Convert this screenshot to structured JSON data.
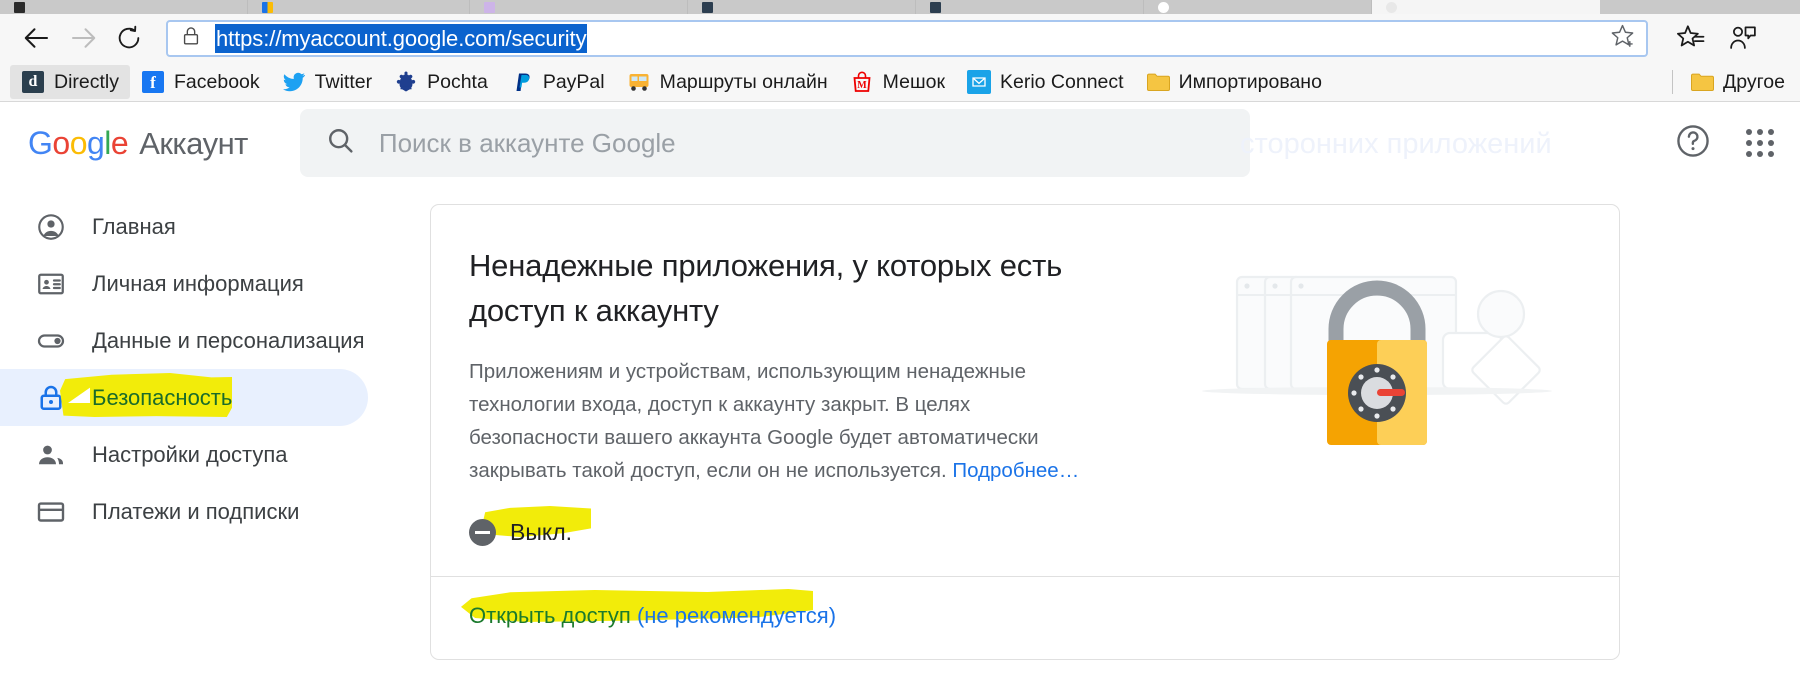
{
  "browser": {
    "nav": {
      "back_icon": "arrow-left-icon",
      "forward_icon": "arrow-right-icon",
      "reload_icon": "reload-icon",
      "lock_icon": "lock-icon",
      "url": "https://myaccount.google.com/security",
      "favorite_icon": "star-add-icon",
      "favorites_list_icon": "favorites-list-icon",
      "collections_icon": "collections-icon",
      "windows_icon": "windows-logo-icon"
    },
    "bookmarks": [
      {
        "label": "Directly",
        "icon": "directly-favicon"
      },
      {
        "label": "Facebook",
        "icon": "facebook-favicon"
      },
      {
        "label": "Twitter",
        "icon": "twitter-favicon"
      },
      {
        "label": "Pochta",
        "icon": "pochta-favicon"
      },
      {
        "label": "PayPal",
        "icon": "paypal-favicon"
      },
      {
        "label": "Маршруты онлайн",
        "icon": "routes-favicon"
      },
      {
        "label": "Мешок",
        "icon": "meshok-favicon"
      },
      {
        "label": "Kerio Connect",
        "icon": "kerio-favicon"
      },
      {
        "label": "Импортировано",
        "icon": "folder-icon"
      }
    ],
    "bookmarks_overflow": {
      "label": "Другое",
      "icon": "folder-icon"
    }
  },
  "header": {
    "logo": {
      "g1": "G",
      "o1": "o",
      "o2": "o",
      "g2": "g",
      "l1": "l",
      "e1": "e",
      "product": "Аккаунт"
    },
    "search": {
      "placeholder": "Поиск в аккаунте Google",
      "icon": "search-icon"
    },
    "ghost_text": "сторонних приложений",
    "help_icon": "help-circle-icon",
    "apps_icon": "apps-grid-icon"
  },
  "sidebar": {
    "items": [
      {
        "label": "Главная",
        "icon": "person-circle-icon",
        "active": false
      },
      {
        "label": "Личная информация",
        "icon": "id-card-icon",
        "active": false
      },
      {
        "label": "Данные и персонализация",
        "icon": "toggle-switch-icon",
        "active": false
      },
      {
        "label": "Безопасность",
        "icon": "lock-shield-icon",
        "active": true
      },
      {
        "label": "Настройки доступа",
        "icon": "people-icon",
        "active": false
      },
      {
        "label": "Платежи и подписки",
        "icon": "credit-card-icon",
        "active": false
      }
    ]
  },
  "card": {
    "title": "Ненадежные приложения, у которых есть доступ к аккаунту",
    "description": "Приложениям и устройствам, использующим ненадежные технологии входа, доступ к аккаунту закрыт. В целях безопасности вашего аккаунта Google будет автоматически закрывать такой доступ, если он не используется. ",
    "learn_more": "Подробнее…",
    "status": {
      "label": "Выкл.",
      "icon": "minus-circle-icon"
    },
    "footer_link": {
      "green_part": "Открыть доступ",
      "blue_part": " (не рекомендуется)"
    },
    "illustration": "unlocked-padlock-illustration"
  },
  "colors": {
    "accent_blue": "#1a73e8",
    "active_nav_bg": "#e8f0fe",
    "marker_yellow": "#f2ec0a",
    "green_ink": "#1b7a2d",
    "url_selection": "#0b63ce",
    "padlock_orange": "#f5a302"
  }
}
